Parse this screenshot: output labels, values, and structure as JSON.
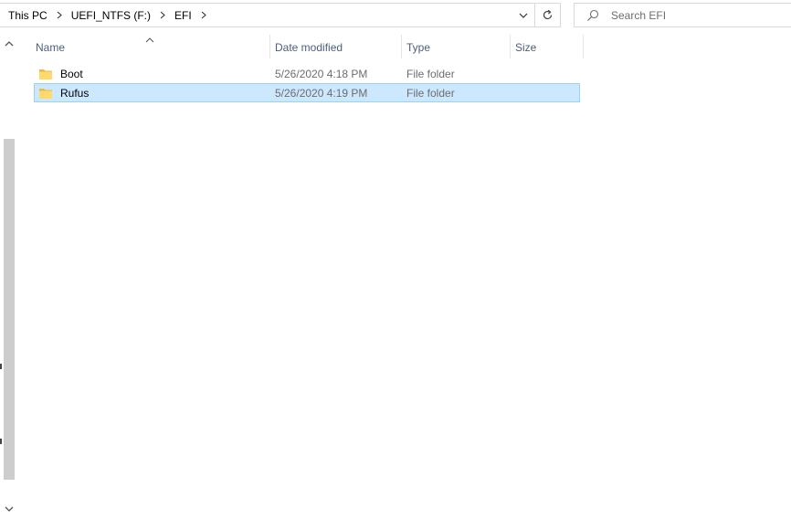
{
  "address": {
    "breadcrumbs": [
      "This PC",
      "UEFI_NTFS (F:)",
      "EFI"
    ]
  },
  "search": {
    "placeholder": "Search EFI"
  },
  "columns": {
    "name": "Name",
    "date_modified": "Date modified",
    "type": "Type",
    "size": "Size",
    "sorted_by": "Name"
  },
  "files": [
    {
      "name": "Boot",
      "date_modified": "5/26/2020 4:18 PM",
      "type": "File folder",
      "size": "",
      "selected": false
    },
    {
      "name": "Rufus",
      "date_modified": "5/26/2020 4:19 PM",
      "type": "File folder",
      "size": "",
      "selected": true
    }
  ],
  "icons": {
    "folder": "folder-icon",
    "refresh": "refresh-icon",
    "search": "search-icon",
    "dropdown": "chevron-down-icon",
    "separator": "chevron-right-icon",
    "sort": "chevron-up-icon"
  },
  "colors": {
    "selection_bg": "#cce8ff",
    "selection_border": "#99d1ff",
    "header_text": "#4c607a",
    "folder_yellow": "#ffd96b"
  }
}
